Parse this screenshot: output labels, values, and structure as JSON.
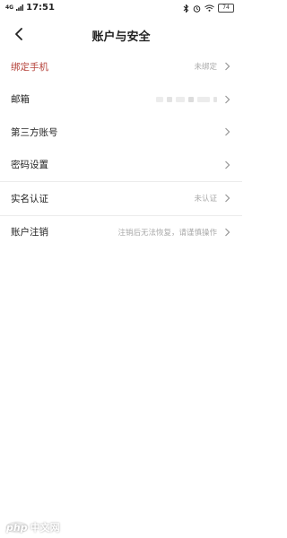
{
  "statusbar": {
    "signal": "4G",
    "time": "17:51",
    "battery": "74"
  },
  "header": {
    "title": "账户与安全"
  },
  "rows": [
    {
      "label": "绑定手机",
      "value": "未绑定",
      "accent": true
    },
    {
      "label": "邮箱",
      "value": ""
    },
    {
      "label": "第三方账号",
      "value": ""
    },
    {
      "label": "密码设置",
      "value": ""
    },
    {
      "label": "实名认证",
      "value": "未认证"
    },
    {
      "label": "账户注销",
      "value": "注销后无法恢复，请谨慎操作"
    }
  ],
  "watermark": {
    "brand": "php",
    "site": "中文网"
  },
  "colors": {
    "accent": "#b5423a",
    "muted": "#aaaaaa",
    "divider": "#ececec"
  }
}
